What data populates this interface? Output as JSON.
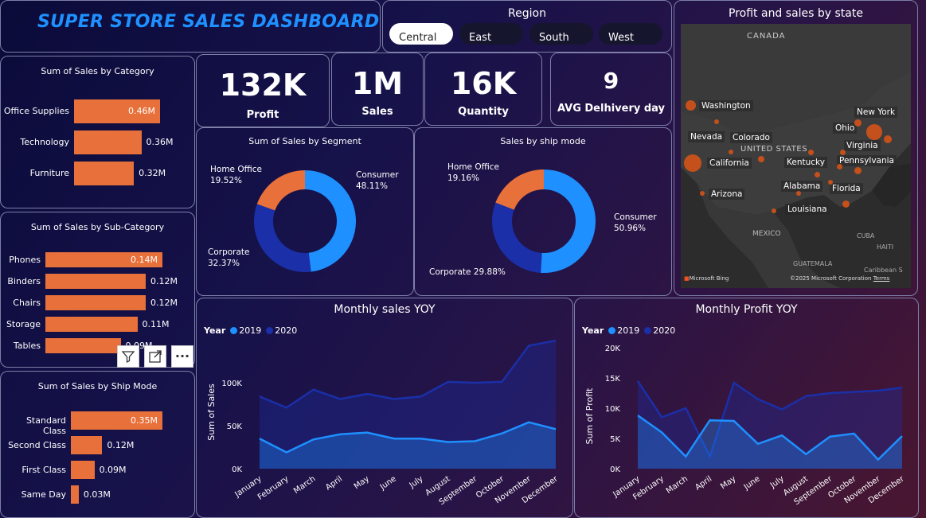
{
  "title": "SUPER STORE SALES DASHBOARD",
  "region": {
    "title": "Region",
    "options": [
      "Central",
      "East",
      "South",
      "West"
    ],
    "selected": "Central"
  },
  "kpis": [
    {
      "value": "132K",
      "label": "Profit"
    },
    {
      "value": "1M",
      "label": "Sales"
    },
    {
      "value": "16K",
      "label": "Quantity"
    },
    {
      "value": "9",
      "label": "AVG Delhivery day"
    }
  ],
  "category_chart": {
    "title": "Sum of Sales by Category",
    "items": [
      {
        "label": "Office Supplies",
        "value": 0.46,
        "text": "0.46M"
      },
      {
        "label": "Technology",
        "value": 0.36,
        "text": "0.36M"
      },
      {
        "label": "Furniture",
        "value": 0.32,
        "text": "0.32M"
      }
    ]
  },
  "subcategory_chart": {
    "title": "Sum of Sales by Sub-Category",
    "items": [
      {
        "label": "Phones",
        "value": 0.14,
        "text": "0.14M"
      },
      {
        "label": "Binders",
        "value": 0.12,
        "text": "0.12M"
      },
      {
        "label": "Chairs",
        "value": 0.12,
        "text": "0.12M"
      },
      {
        "label": "Storage",
        "value": 0.11,
        "text": "0.11M"
      },
      {
        "label": "Tables",
        "value": 0.09,
        "text": "0.09M"
      }
    ]
  },
  "shipmode_bar_chart": {
    "title": "Sum of Sales by Ship Mode",
    "items": [
      {
        "label": "Standard Class",
        "value": 0.35,
        "text": "0.35M"
      },
      {
        "label": "Second Class",
        "value": 0.12,
        "text": "0.12M"
      },
      {
        "label": "First Class",
        "value": 0.09,
        "text": "0.09M"
      },
      {
        "label": "Same Day",
        "value": 0.03,
        "text": "0.03M"
      }
    ]
  },
  "segment_donut": {
    "title": "Sum of Sales by Segment",
    "slices": [
      {
        "name": "Consumer",
        "pct": 48.11,
        "text": "48.11%",
        "color": "#1e90ff"
      },
      {
        "name": "Corporate",
        "pct": 32.37,
        "text": "32.37%",
        "color": "#1a2fa8"
      },
      {
        "name": "Home Office",
        "pct": 19.52,
        "text": "19.52%",
        "color": "#e8703a"
      }
    ]
  },
  "shipmode_donut": {
    "title": "Sales by ship mode",
    "slices": [
      {
        "name": "Consumer",
        "pct": 50.96,
        "text": "50.96%",
        "color": "#1e90ff"
      },
      {
        "name": "Corporate",
        "pct": 29.88,
        "text": "29.88%",
        "color": "#1a2fa8"
      },
      {
        "name": "Home Office",
        "pct": 19.16,
        "text": "19.16%",
        "color": "#e8703a"
      }
    ]
  },
  "map": {
    "title": "Profit and sales by state",
    "labels": [
      "CANADA",
      "UNITED STATES",
      "MEXICO",
      "Washington",
      "New York",
      "Ohio",
      "Nevada",
      "Colorado",
      "Virginia",
      "California",
      "Kentucky",
      "Pennsylvania",
      "Alabama",
      "Florida",
      "Arizona",
      "Louisiana",
      "CUBA",
      "HAITI",
      "GUATEMALA",
      "Caribbean S"
    ],
    "brand": "Microsoft Bing",
    "copyright": "©2025 Microsoft Corporation",
    "terms": "Terms"
  },
  "visual_toolbar": {
    "filter_icon": "filter-icon",
    "focus_icon": "focus-mode-icon",
    "more_icon": "more-options-icon"
  },
  "chart_data": [
    {
      "type": "area",
      "title": "Monthly sales YOY",
      "legend_title": "Year",
      "xlabel": "",
      "ylabel": "Sum of Sales",
      "categories": [
        "January",
        "February",
        "March",
        "April",
        "May",
        "June",
        "July",
        "August",
        "September",
        "October",
        "November",
        "December"
      ],
      "yticks": [
        "0K",
        "50K",
        "100K"
      ],
      "ylim": [
        0,
        150000
      ],
      "series": [
        {
          "name": "2019",
          "color": "#1e90ff",
          "values": [
            35000,
            19000,
            34000,
            40000,
            42000,
            35000,
            35000,
            31000,
            32000,
            41000,
            54000,
            46000
          ]
        },
        {
          "name": "2020",
          "color": "#1a2fa8",
          "values": [
            84000,
            71000,
            92000,
            81000,
            87000,
            81000,
            84000,
            101000,
            100000,
            101000,
            143000,
            149000
          ]
        }
      ]
    },
    {
      "type": "area",
      "title": "Monthly Profit YOY",
      "legend_title": "Year",
      "xlabel": "",
      "ylabel": "Sum of Profit",
      "categories": [
        "January",
        "February",
        "March",
        "April",
        "May",
        "June",
        "July",
        "August",
        "September",
        "October",
        "November",
        "December"
      ],
      "yticks": [
        "0K",
        "5K",
        "10K",
        "15K",
        "20K"
      ],
      "ylim": [
        0,
        20000
      ],
      "series": [
        {
          "name": "2019",
          "color": "#1e90ff",
          "values": [
            8800,
            6000,
            2000,
            8000,
            7900,
            4100,
            5500,
            2400,
            5300,
            5800,
            1500,
            5400
          ]
        },
        {
          "name": "2020",
          "color": "#1a2fa8",
          "values": [
            14500,
            8500,
            10000,
            2000,
            14200,
            11500,
            9800,
            12000,
            12500,
            12700,
            12900,
            13400
          ]
        }
      ]
    }
  ]
}
